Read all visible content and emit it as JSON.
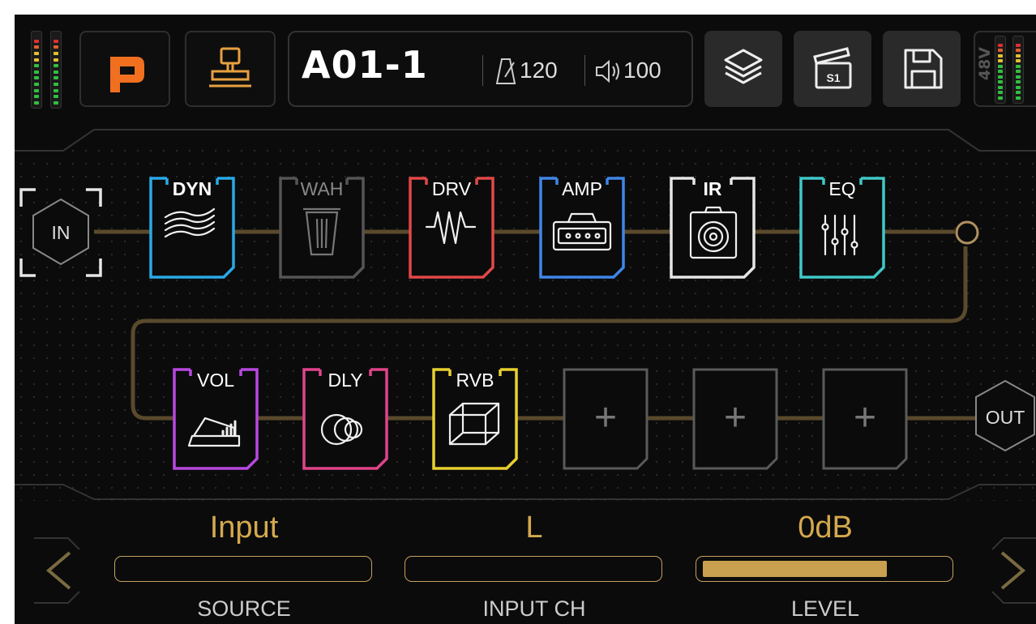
{
  "header": {
    "patch_name": "A01-1",
    "tempo": "120",
    "volume": "100",
    "phantom_power_label": "48V"
  },
  "chain": {
    "input_label": "IN",
    "output_label": "OUT",
    "blocks_row1": [
      {
        "label": "DYN",
        "color": "#29a9e8",
        "icon": "dynamics-waves-icon",
        "active": true
      },
      {
        "label": "WAH",
        "color": "#555555",
        "icon": "wah-pedal-icon",
        "active": false
      },
      {
        "label": "DRV",
        "color": "#e24848",
        "icon": "drive-square-wave-icon",
        "active": true
      },
      {
        "label": "AMP",
        "color": "#3f86e8",
        "icon": "amp-head-icon",
        "active": true
      },
      {
        "label": "IR",
        "color": "#e6e6e6",
        "icon": "speaker-cab-icon",
        "active": true
      },
      {
        "label": "EQ",
        "color": "#3fc8c8",
        "icon": "eq-sliders-icon",
        "active": true
      }
    ],
    "blocks_row2": [
      {
        "label": "VOL",
        "color": "#b848e0",
        "icon": "volume-pedal-icon",
        "active": true
      },
      {
        "label": "DLY",
        "color": "#e0448a",
        "icon": "delay-circles-icon",
        "active": true
      },
      {
        "label": "RVB",
        "color": "#e8d030",
        "icon": "reverb-cube-icon",
        "active": true
      }
    ],
    "empty_slot_symbol": "+"
  },
  "params": {
    "source": {
      "value": "Input",
      "label": "SOURCE"
    },
    "input_ch": {
      "value": "L",
      "label": "INPUT CH"
    },
    "level": {
      "value": "0dB",
      "label": "LEVEL",
      "fill_fraction": 0.75
    }
  },
  "colors": {
    "accent_gold": "#c9a050",
    "cable": "#5a4a2c",
    "logo_orange": "#f07020",
    "scene_icon": "#e8a040"
  }
}
